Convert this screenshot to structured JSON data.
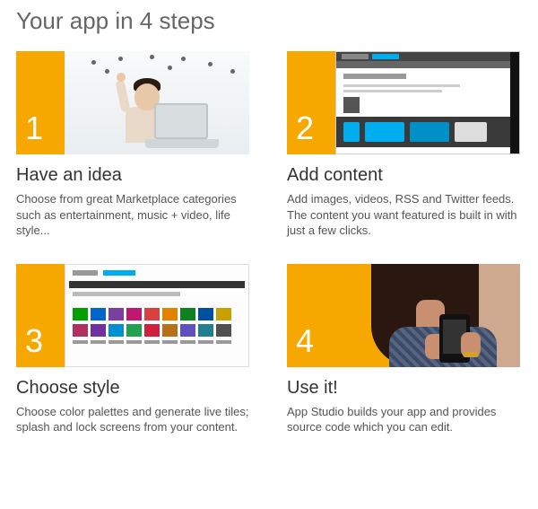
{
  "page": {
    "title": "Your app in 4 steps"
  },
  "steps": [
    {
      "num": "1",
      "title": "Have an idea",
      "desc": "Choose from great Marketplace categories such as entertainment, music + video, life style..."
    },
    {
      "num": "2",
      "title": "Add content",
      "desc": "Add images, videos, RSS and Twitter feeds. The content you want featured is built in with just a few clicks."
    },
    {
      "num": "3",
      "title": "Choose style",
      "desc": "Choose color palettes and generate live tiles; splash and lock screens from your content."
    },
    {
      "num": "4",
      "title": "Use it!",
      "desc": "App Studio builds your app and provides source code which you can edit."
    }
  ]
}
